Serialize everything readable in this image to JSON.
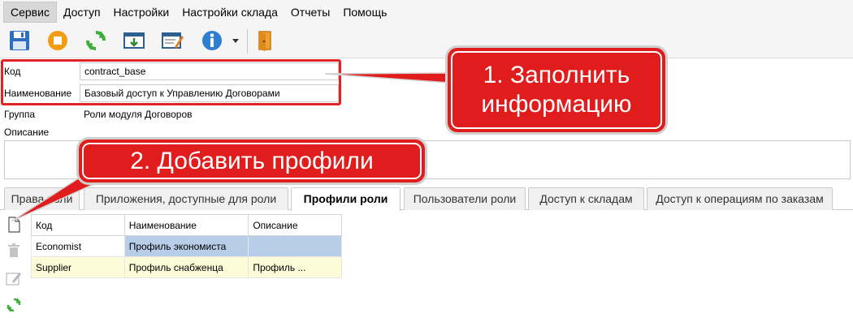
{
  "menu": {
    "items": [
      "Сервис",
      "Доступ",
      "Настройки",
      "Настройки склада",
      "Отчеты",
      "Помощь"
    ]
  },
  "toolbar": {
    "icons": [
      "save-icon",
      "stop-icon",
      "refresh-icon",
      "import-icon",
      "edit-table-icon",
      "info-icon",
      "dropdown-arrow-icon",
      "exit-door-icon"
    ]
  },
  "form": {
    "code_label": "Код",
    "code_value": "contract_base",
    "name_label": "Наименование",
    "name_value": "Базовый доступ к Управлению Договорами",
    "group_label": "Группа",
    "group_value": "Роли модуля Договоров",
    "description_label": "Описание",
    "description_value": ""
  },
  "tabs": [
    {
      "label": "Права роли"
    },
    {
      "label": "Приложения, доступные для роли"
    },
    {
      "label": "Профили роли"
    },
    {
      "label": "Пользователи роли"
    },
    {
      "label": "Доступ к складам"
    },
    {
      "label": "Доступ к операциям по заказам"
    }
  ],
  "grid": {
    "columns": [
      "Код",
      "Наименование",
      "Описание"
    ],
    "rows": [
      {
        "code": "Economist",
        "name": "Профиль экономиста",
        "description": ""
      },
      {
        "code": "Supplier",
        "name": "Профиль снабженца",
        "description": "Профиль ..."
      }
    ]
  },
  "callouts": {
    "fill_info": "1. Заполнить информацию",
    "add_profiles": "2. Добавить профили"
  },
  "colors": {
    "accent_red": "#e01c1c",
    "selected_cell": "#b8cde8",
    "alt_row": "#fdfbd8"
  }
}
